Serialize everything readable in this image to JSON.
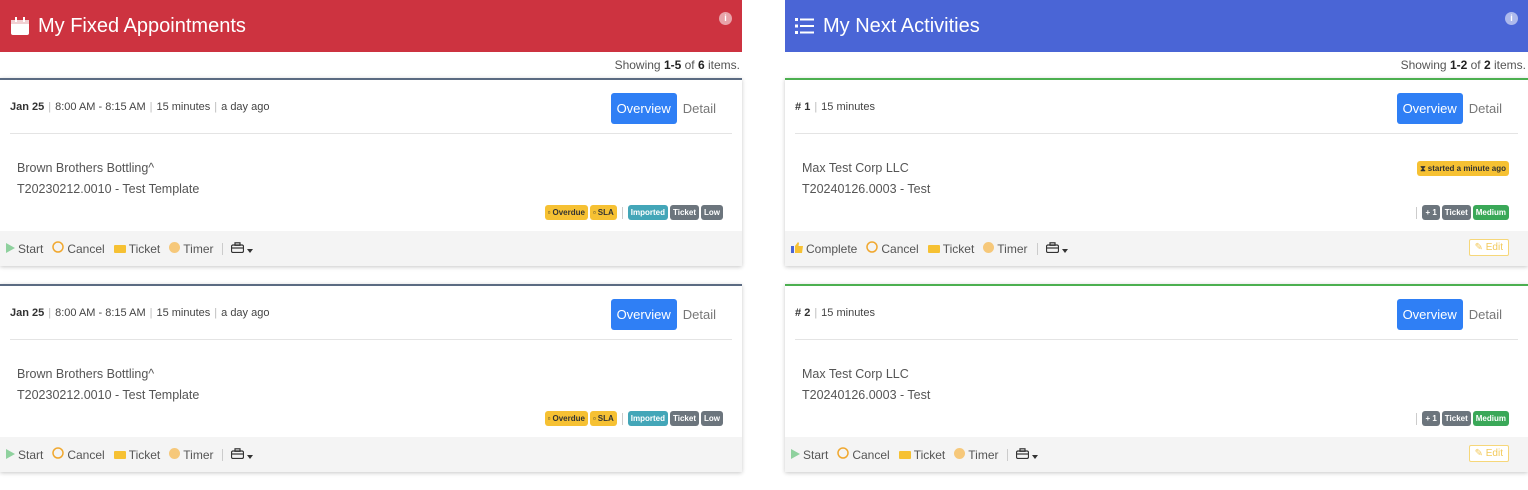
{
  "left": {
    "title": "My Fixed Appointments",
    "header_color": "#cd3340",
    "card_border_color": "#5b6b82",
    "showing": {
      "prefix": "Showing ",
      "range": "1-5",
      "mid": " of ",
      "total": "6",
      "suffix": " items."
    },
    "cards": [
      {
        "date": "Jan 25",
        "time": "8:00 AM - 8:15 AM",
        "duration": "15 minutes",
        "ago": "a day ago",
        "overview_label": "Overview",
        "detail_label": "Detail",
        "company": "Brown Brothers Bottling^",
        "ticket": "T20230212.0010 - Test Template",
        "badges": {
          "overdue": "Overdue",
          "sla": "SLA",
          "imported": "Imported",
          "ticket": "Ticket",
          "priority": "Low"
        },
        "actions": {
          "start": "Start",
          "cancel": "Cancel",
          "ticket": "Ticket",
          "timer": "Timer"
        }
      },
      {
        "date": "Jan 25",
        "time": "8:00 AM - 8:15 AM",
        "duration": "15 minutes",
        "ago": "a day ago",
        "overview_label": "Overview",
        "detail_label": "Detail",
        "company": "Brown Brothers Bottling^",
        "ticket": "T20230212.0010 - Test Template",
        "badges": {
          "overdue": "Overdue",
          "sla": "SLA",
          "imported": "Imported",
          "ticket": "Ticket",
          "priority": "Low"
        },
        "actions": {
          "start": "Start",
          "cancel": "Cancel",
          "ticket": "Ticket",
          "timer": "Timer"
        }
      }
    ]
  },
  "right": {
    "title": "My Next Activities",
    "header_color": "#4a65d6",
    "card_border_color": "#4caf50",
    "showing": {
      "prefix": "Showing ",
      "range": "1-2",
      "mid": " of ",
      "total": "2",
      "suffix": " items."
    },
    "cards": [
      {
        "number": "1",
        "duration": "15 minutes",
        "overview_label": "Overview",
        "detail_label": "Detail",
        "company": "Max Test Corp LLC",
        "ticket": "T20240126.0003 - Test",
        "status": "started a minute ago",
        "badges": {
          "count": "+ 1",
          "ticket": "Ticket",
          "priority": "Medium"
        },
        "actions": {
          "primary": "Complete",
          "cancel": "Cancel",
          "ticket": "Ticket",
          "timer": "Timer"
        },
        "edit_label": "Edit"
      },
      {
        "number": "2",
        "duration": "15 minutes",
        "overview_label": "Overview",
        "detail_label": "Detail",
        "company": "Max Test Corp LLC",
        "ticket": "T20240126.0003 - Test",
        "badges": {
          "count": "+ 1",
          "ticket": "Ticket",
          "priority": "Medium"
        },
        "actions": {
          "primary": "Start",
          "cancel": "Cancel",
          "ticket": "Ticket",
          "timer": "Timer"
        },
        "edit_label": "Edit"
      }
    ]
  },
  "icons": {
    "info": "i"
  }
}
